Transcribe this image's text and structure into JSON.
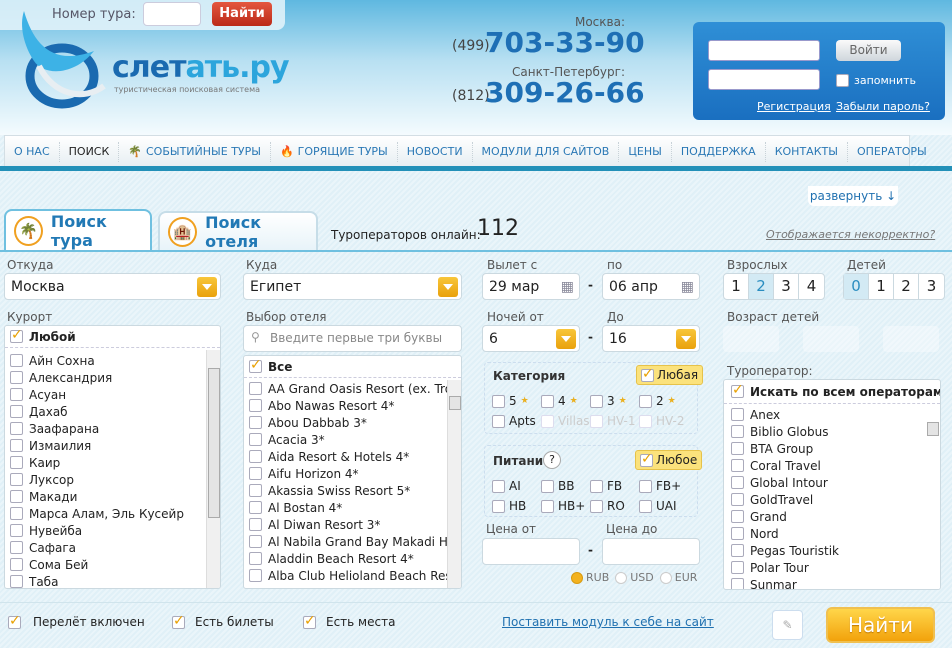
{
  "header": {
    "tour_number_label": "Номер тура:",
    "tour_number_value": "",
    "tour_search_button": "Найти",
    "brand_part1": "слет",
    "brand_part2": "ать.ру",
    "slogan": "туристическая поисковая система",
    "moscow": {
      "city": "Москва:",
      "code": "(499)",
      "phone": "703-33-90"
    },
    "spb": {
      "city": "Санкт-Петербург:",
      "code": "(812)",
      "phone": "309-26-66"
    },
    "login": {
      "login_value": "",
      "password_value": "",
      "button": "Войти",
      "remember": "запомнить",
      "register": "Регистрация",
      "forgot": "Забыли пароль?"
    }
  },
  "nav": {
    "items": [
      "О НАС",
      "ПОИСК",
      "СОБЫТИЙНЫЕ ТУРЫ",
      "ГОРЯЩИЕ ТУРЫ",
      "НОВОСТИ",
      "МОДУЛИ ДЛЯ САЙТОВ",
      "ЦЕНЫ",
      "ПОДДЕРЖКА",
      "КОНТАКТЫ",
      "ОПЕРАТОРЫ"
    ],
    "active": "ПОИСК"
  },
  "expand": "развернуть ↓",
  "tabs": {
    "tour": "Поиск тура",
    "hotel": "Поиск отеля",
    "operators_online_label": "Туроператоров онлайн:",
    "operators_online_count": "112",
    "incorrect_link": "Отображается некорректно?"
  },
  "form": {
    "from": {
      "label": "Откуда",
      "value": "Москва"
    },
    "to": {
      "label": "Куда",
      "value": "Египет"
    },
    "resort": {
      "label": "Курорт",
      "any": "Любой",
      "items": [
        "Айн Сохна",
        "Александрия",
        "Асуан",
        "Дахаб",
        "Заафарана",
        "Измаилия",
        "Каир",
        "Луксор",
        "Макади",
        "Марса Алам, Эль Кусейр",
        "Нувейба",
        "Сафага",
        "Сома Бей",
        "Таба"
      ]
    },
    "hotel": {
      "label": "Выбор отеля",
      "placeholder": "Введите первые три буквы",
      "all": "Все",
      "items": [
        "AA Grand Oasis Resort (ex. Tro",
        "Abo Nawas Resort 4*",
        "Abou Dabbab 3*",
        "Acacia 3*",
        "Aida Resort & Hotels 4*",
        "Aifu Horizon 4*",
        "Akassia Swiss Resort 5*",
        "Al Bostan 4*",
        "Al Diwan Resort 3*",
        "Al Nabila Grand Bay Makadi Hot",
        "Aladdin Beach Resort 4*",
        "Alba Club Helioland Beach Reso"
      ]
    },
    "depart_from": {
      "label": "Вылет с",
      "value": "29 мар"
    },
    "depart_to": {
      "label": "по",
      "value": "06 апр"
    },
    "nights_from": {
      "label": "Ночей от",
      "value": "6"
    },
    "nights_to": {
      "label": "До",
      "value": "16"
    },
    "adults": {
      "label": "Взрослых",
      "options": [
        "1",
        "2",
        "3",
        "4"
      ],
      "selected": "2"
    },
    "children": {
      "label": "Детей",
      "options": [
        "0",
        "1",
        "2",
        "3"
      ],
      "selected": "0"
    },
    "children_age": {
      "label": "Возраст детей"
    },
    "category": {
      "label": "Категория",
      "any": "Любая",
      "options": [
        "5",
        "4",
        "3",
        "2",
        "Apts",
        "Villas",
        "HV-1",
        "HV-2"
      ]
    },
    "meal": {
      "label": "Питание",
      "help": "?",
      "any": "Любое",
      "options": [
        "AI",
        "BB",
        "FB",
        "FB+",
        "HB",
        "HB+",
        "RO",
        "UAI"
      ]
    },
    "price_from": {
      "label": "Цена от",
      "value": ""
    },
    "price_to": {
      "label": "Цена до",
      "value": ""
    },
    "currency": {
      "options": [
        "RUB",
        "USD",
        "EUR"
      ],
      "selected": "RUB"
    },
    "operator": {
      "label": "Туроператор:",
      "all": "Искать по всем операторам",
      "items": [
        "Anex",
        "Biblio Globus",
        "BTA Group",
        "Coral Travel",
        "Global Intour",
        "GoldTravel",
        "Grand",
        "Nord",
        "Pegas Touristik",
        "Polar Tour",
        "Sunmar"
      ]
    },
    "flight_included": "Перелёт включен",
    "tickets": "Есть билеты",
    "seats": "Есть места",
    "module_link": "Поставить модуль к себе на сайт",
    "search_button": "Найти"
  },
  "colors": {
    "accent": "#2290b8",
    "orange": "#f3b21f",
    "brand_blue": "#1e6fb5",
    "red": "#c8351f"
  }
}
